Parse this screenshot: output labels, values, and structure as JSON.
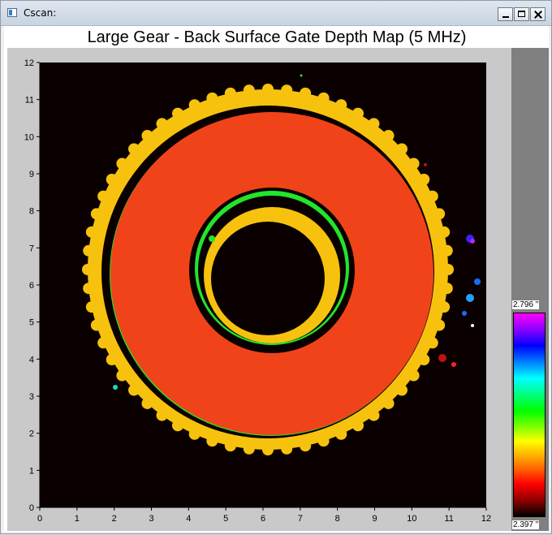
{
  "window": {
    "title": "Cscan:",
    "buttons": {
      "minimize": "minimize",
      "maximize": "maximize",
      "close": "close"
    }
  },
  "plot": {
    "title": "Large Gear - Back Surface Gate Depth Map (5 MHz)",
    "x_ticks": [
      "0",
      "1",
      "2",
      "3",
      "4",
      "5",
      "6",
      "7",
      "8",
      "9",
      "10",
      "11",
      "12"
    ],
    "y_ticks": [
      "0",
      "1",
      "2",
      "3",
      "4",
      "5",
      "6",
      "7",
      "8",
      "9",
      "10",
      "11",
      "12"
    ],
    "x_range": [
      0,
      12
    ],
    "y_range": [
      0,
      12
    ]
  },
  "color_scale": {
    "max_label": "2.796 \"",
    "min_label": "2.397 \"",
    "colors": {
      "background": "#0a0000",
      "gear_outer_ring": "#f7c20e",
      "gear_face": "#f1431a",
      "inner_ring": "#f7c20e",
      "edge_green": "#22e52a"
    }
  }
}
